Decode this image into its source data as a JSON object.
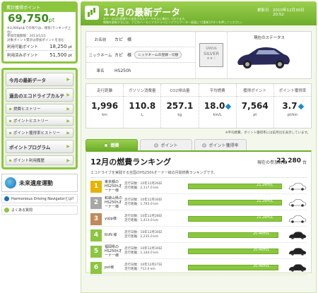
{
  "sidebar": {
    "points_header": "累計獲得ポイント",
    "points_total": "69,750",
    "points_unit": "pt",
    "points_note": "※3,000ptまでの残りは、保有(ランキング上位)\n参加可能期限：2013/1/31\n対象ポイント累計は参加ポイントを含む",
    "usable_label": "利用可能ポイント",
    "usable_value": "18,250",
    "usable_unit": "pt",
    "used_label": "利用済みポイント",
    "used_value": "51,500",
    "used_unit": "pt",
    "menu": [
      {
        "label": "今月の最新データ",
        "size": "big"
      },
      {
        "label": "過去のエコドライブカルテ",
        "size": "big"
      },
      {
        "label": "燃費ヒストリー",
        "size": "small"
      },
      {
        "label": "ポイントヒストリー",
        "size": "small"
      },
      {
        "label": "ポイント獲得率ヒストリー",
        "size": "small"
      },
      {
        "label": "ポイントプログラム",
        "size": "big"
      },
      {
        "label": "ポイント利用履歴",
        "size": "small"
      }
    ],
    "logo_text": "未来遺産運動",
    "link1": "Harmonious Driving Navigatorとは?",
    "link2": "よくある質問"
  },
  "header": {
    "title": "12月の最新データ",
    "date_label": "更新日",
    "date_value": "2010年12月30日　20:52",
    "note": "※データはお客様から送信されたデータを元に集計しております。\n情報を更新するには、ナビのハーモニアスドライビングナビゲーター画面にて[更新]ボタンを押してください。"
  },
  "profile": {
    "name_label": "お名前",
    "name_value": "カピ　様",
    "nick_label": "ニックネーム",
    "nick_value": "カピ　様",
    "nick_button": "ニックネームの登録・切替",
    "car_label": "車名",
    "car_value": "HS250h",
    "status_label": "現在のステータス",
    "badge_top": "STATUS",
    "badge_main": "SILVER",
    "badge_stars": "★★☆"
  },
  "stats": [
    {
      "label": "走行距離",
      "value": "1,996",
      "unit": "km",
      "arrow": false
    },
    {
      "label": "ガソリン消費量",
      "value": "110.8",
      "unit": "L",
      "arrow": false
    },
    {
      "label": "CO2排出量",
      "value": "257.1",
      "unit": "kg",
      "arrow": false
    },
    {
      "label": "平均燃費",
      "value": "18.0",
      "unit": "km/L",
      "arrow": true
    },
    {
      "label": "獲得ポイント",
      "value": "7,564",
      "unit": "pt",
      "arrow": false
    },
    {
      "label": "ポイント獲得率",
      "value": "3.7",
      "unit": "pt/km",
      "arrow": true
    }
  ],
  "stats_note": "※平均燃費、ポイント獲得率には前月比を表示しています。",
  "tabs": [
    "燃費",
    "ポイント",
    "ポイント獲得率"
  ],
  "ranking": {
    "title": "12月の燃費ランキング",
    "count_label": "現在の参加台数",
    "count_value": "22,280",
    "count_unit": "台",
    "desc": "エコドライブを実践する全国のHS250hオーナー様の月間燃費ランキングです。",
    "colors": [
      "#e6b400",
      "#a7a7a7",
      "#c08a5a",
      "#8cc63f",
      "#8cc63f",
      "#8cc63f"
    ],
    "rows": [
      {
        "rank": "1",
        "name": "東京都の\nHS250hオーナー様",
        "date": "走行日数：10年12月26日",
        "dist": "走行距離：2,117.0 km",
        "value": "21.2km/L",
        "fuel": 21.2
      },
      {
        "rank": "2",
        "name": "和歌山県の\nHS250hオーナー様",
        "date": "走行日数：10年12月30日",
        "dist": "走行距離：1,793.0 km",
        "value": "21.2km/L",
        "fuel": 21.2
      },
      {
        "rank": "3",
        "name": "yojip様",
        "date": "走行日数：10年12月28日",
        "dist": "走行距離：1,413.0 km",
        "value": "21.2km/L",
        "fuel": 21.2
      },
      {
        "rank": "4",
        "name": "RUN 様",
        "date": "走行日数：10年12月30日",
        "dist": "走行距離：2,235.0 km",
        "value": "20.4km/L",
        "fuel": 20.4
      },
      {
        "rank": "5",
        "name": "福岡県の\nHS250hオーナー様",
        "date": "走行日数：10年12月30日",
        "dist": "走行距離：1,144.0 km",
        "value": "20.4km/L",
        "fuel": 20.4
      },
      {
        "rank": "6",
        "name": "pxt様",
        "date": "走行日数：10年12月27日",
        "dist": "走行距離：712.0 km",
        "value": "20.4km/L",
        "fuel": 20.4
      }
    ]
  }
}
